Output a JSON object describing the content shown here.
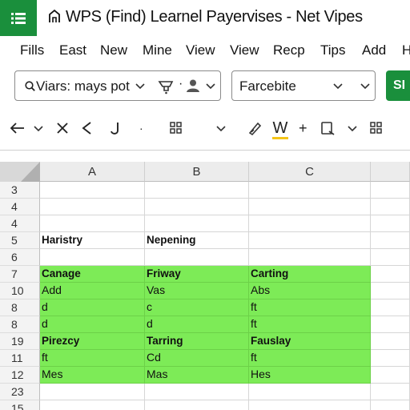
{
  "titlebar": {
    "icon": "spreadsheet-menu-icon",
    "home_icon": "home-icon",
    "title": "WPS (Find) Learnel Payervises - Net Vipes"
  },
  "menu": [
    "Fills",
    "East",
    "New",
    "Mine",
    "View",
    "View",
    "Recp",
    "Tips",
    "Add",
    "H"
  ],
  "toolbar": {
    "search_text": "Viars: mays pot",
    "font_value": "Farcebite",
    "green_button_label": "SI"
  },
  "icons": {
    "search": "search-icon",
    "paint_bucket": "paint-bucket-icon",
    "user": "user-icon",
    "back_arrow": "arrow-left-icon",
    "close": "close-icon",
    "undo": "undo-icon",
    "redo": "redo-icon",
    "format_painter": "format-painter-icon",
    "highlight": "highlight-icon",
    "clipboard": "clipboard-icon",
    "grid": "grid-icon"
  },
  "toolbar2": {
    "w_label": "W",
    "plus_label": "+",
    "dot_label": "·"
  },
  "colors": {
    "app_green": "#1a8f3c",
    "cell_highlight": "#7deb57",
    "underline_yellow": "#f5c518"
  },
  "sheet": {
    "columns": [
      "A",
      "B",
      "C"
    ],
    "rows": [
      {
        "num": "3",
        "cells": [
          "",
          "",
          ""
        ]
      },
      {
        "num": "4",
        "cells": [
          "",
          "",
          ""
        ]
      },
      {
        "num": "4",
        "cells": [
          "",
          "",
          ""
        ]
      },
      {
        "num": "5",
        "cells": [
          "Haristry",
          "Nepening",
          ""
        ]
      },
      {
        "num": "6",
        "cells": [
          "",
          "",
          ""
        ]
      },
      {
        "num": "7",
        "cells": [
          "Canage",
          "Friway",
          "Carting"
        ]
      },
      {
        "num": "10",
        "cells": [
          "Add",
          "Vas",
          "Abs"
        ]
      },
      {
        "num": "8",
        "cells": [
          "d",
          "c",
          "ft"
        ]
      },
      {
        "num": "8",
        "cells": [
          "d",
          "d",
          "ft"
        ]
      },
      {
        "num": "19",
        "cells": [
          "Pirezcy",
          "Tarring",
          "Fauslay"
        ]
      },
      {
        "num": "11",
        "cells": [
          "ft",
          "Cd",
          "ft"
        ]
      },
      {
        "num": "12",
        "cells": [
          "Mes",
          "Mas",
          "Hes"
        ]
      },
      {
        "num": "23",
        "cells": [
          "",
          "",
          ""
        ]
      },
      {
        "num": "15",
        "cells": [
          "",
          "",
          ""
        ]
      }
    ]
  }
}
